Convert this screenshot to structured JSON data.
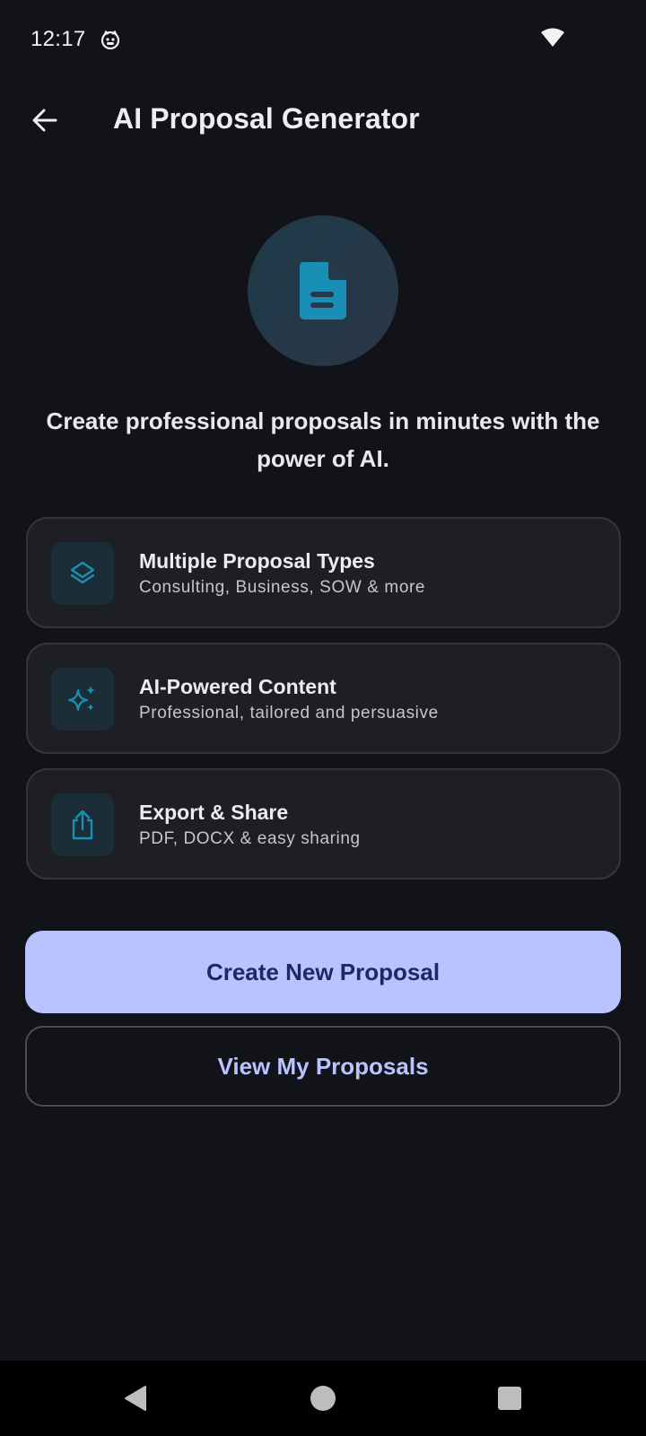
{
  "status_bar": {
    "time": "12:17",
    "notification_icon": "cat-face-icon",
    "wifi_icon": "wifi-icon"
  },
  "app_bar": {
    "back_icon": "arrow-left-icon",
    "title": "AI Proposal Generator"
  },
  "hero": {
    "icon": "document-icon",
    "tagline": "Create professional proposals in minutes with the power of AI."
  },
  "features": [
    {
      "icon": "layers-icon",
      "title": "Multiple Proposal Types",
      "subtitle": "Consulting, Business, SOW & more"
    },
    {
      "icon": "sparkles-icon",
      "title": "AI-Powered Content",
      "subtitle": "Professional, tailored and persuasive"
    },
    {
      "icon": "share-icon",
      "title": "Export & Share",
      "subtitle": "PDF, DOCX & easy sharing"
    }
  ],
  "actions": {
    "primary_label": "Create New Proposal",
    "secondary_label": "View My Proposals"
  },
  "colors": {
    "background": "#121318",
    "card": "#1e1f24",
    "accent_teal": "#1a8fb5",
    "primary_button": "#b8c3ff",
    "primary_button_text": "#1c2a63"
  },
  "nav_bar": {
    "back_icon": "triangle-back-icon",
    "home_icon": "circle-home-icon",
    "recents_icon": "square-recents-icon"
  }
}
